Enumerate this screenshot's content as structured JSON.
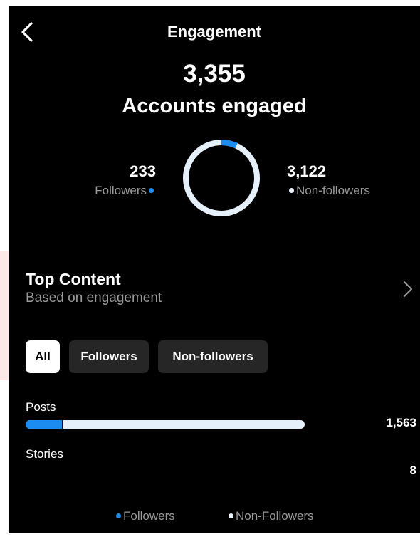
{
  "header": {
    "title": "Engagement"
  },
  "summary": {
    "total": "3,355",
    "label": "Accounts engaged"
  },
  "breakdown": {
    "followers": {
      "value": "233",
      "label": "Followers",
      "count": 233
    },
    "non_followers": {
      "value": "3,122",
      "label": "Non-followers",
      "count": 3122
    }
  },
  "top_content": {
    "title": "Top Content",
    "subtitle": "Based on engagement"
  },
  "filters": [
    {
      "label": "All",
      "active": true
    },
    {
      "label": "Followers",
      "active": false
    },
    {
      "label": "Non-followers",
      "active": false
    }
  ],
  "content_types": [
    {
      "label": "Posts",
      "value": "1,563",
      "total": 1563,
      "followers_fraction": 0.13,
      "bar_fraction": 1.0
    },
    {
      "label": "Stories",
      "value": "8",
      "total": 8,
      "followers_fraction": 0,
      "bar_fraction": 0
    }
  ],
  "legend": {
    "followers": "Followers",
    "non_followers": "Non-Followers"
  },
  "colors": {
    "followers": "#1d8cf0",
    "non_followers": "#e6f0fb",
    "background": "#000000",
    "chip": "#262626"
  },
  "icons": {
    "back": "chevron-left-icon",
    "more": "chevron-right-icon"
  }
}
